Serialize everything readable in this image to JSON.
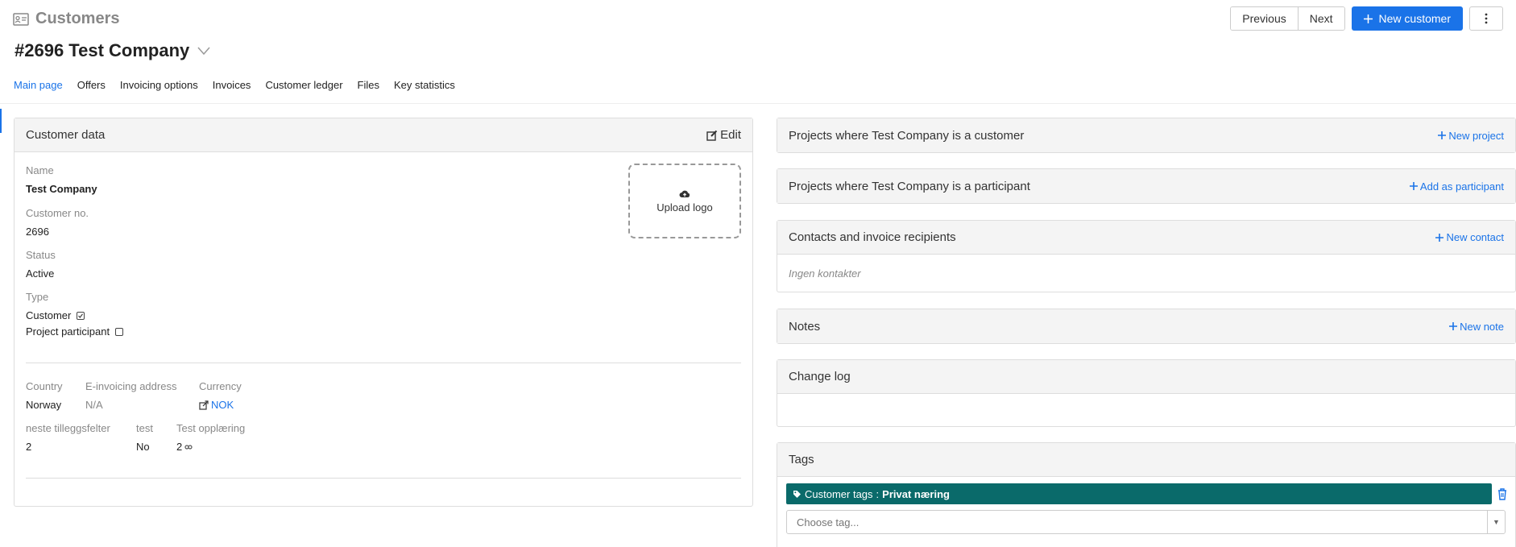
{
  "header": {
    "title": "Customers",
    "icon": "contact-card-icon"
  },
  "actions": {
    "previous": "Previous",
    "next": "Next",
    "new_customer": "New customer"
  },
  "company": {
    "title": "#2696 Test Company"
  },
  "tabs": [
    {
      "label": "Main page",
      "active": true
    },
    {
      "label": "Offers"
    },
    {
      "label": "Invoicing options"
    },
    {
      "label": "Invoices"
    },
    {
      "label": "Customer ledger"
    },
    {
      "label": "Files"
    },
    {
      "label": "Key statistics"
    }
  ],
  "customer_data": {
    "title": "Customer data",
    "edit": "Edit",
    "upload_logo": "Upload logo",
    "name_label": "Name",
    "name_value": "Test Company",
    "customer_no_label": "Customer no.",
    "customer_no_value": "2696",
    "status_label": "Status",
    "status_value": "Active",
    "type_label": "Type",
    "type_customer": "Customer",
    "type_customer_checked": true,
    "type_participant": "Project participant",
    "type_participant_checked": false,
    "country_label": "Country",
    "country_value": "Norway",
    "einvoice_label": "E-invoicing address",
    "einvoice_value": "N/A",
    "currency_label": "Currency",
    "currency_value": "NOK",
    "extra1_label": "neste tilleggsfelter",
    "extra1_value": "2",
    "extra2_label": "test",
    "extra2_value": "No",
    "extra3_label": "Test opplæring",
    "extra3_value": "2"
  },
  "panels": {
    "projects_customer": {
      "title": "Projects where Test Company is a customer",
      "action": "New project"
    },
    "projects_participant": {
      "title": "Projects where Test Company is a participant",
      "action": "Add as participant"
    },
    "contacts": {
      "title": "Contacts and invoice recipients",
      "action": "New contact",
      "empty": "Ingen kontakter"
    },
    "notes": {
      "title": "Notes",
      "action": "New note"
    },
    "changelog": {
      "title": "Change log"
    },
    "tags": {
      "title": "Tags",
      "tag_prefix": "Customer tags",
      "tag_value": "Privat næring",
      "placeholder": "Choose tag..."
    }
  },
  "colors": {
    "accent": "#1a73e8",
    "tag_bg": "#0a6a6a"
  }
}
